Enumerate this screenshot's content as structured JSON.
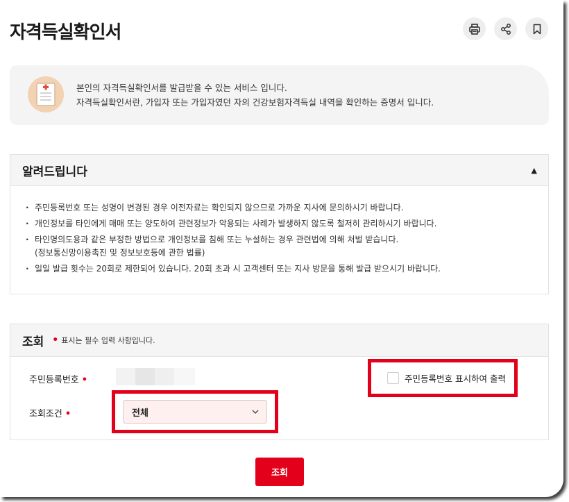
{
  "page": {
    "title": "자격득실확인서"
  },
  "toolbar": {
    "icons": [
      "printer-icon",
      "share-icon",
      "bookmark-icon"
    ]
  },
  "intro": {
    "icon": "medical-document-icon",
    "line1": "본인의 자격득실확인서를 발급받을 수 있는 서비스 입니다.",
    "line2": "자격득실확인서란, 가입자 또는 가입자였던 자의 건강보험자격득실 내역을 확인하는 증명서 입니다."
  },
  "notice": {
    "title": "알려드립니다",
    "toggle_glyph": "▲",
    "items": [
      "주민등록번호 또는 성명이 변경된 경우 이전자료는 확인되지 않으므로 가까운 지사에 문의하시기 바랍니다.",
      "개인정보를 타인에게 매매 또는 양도하여 관련정보가 악용되는 사례가 발생하지 않도록 철저히 관리하시기 바랍니다.",
      "타인명의도용과 같은 부정한 방법으로 개인정보를 침해 또는 누설하는 경우 관련법에 의해 처벌 받습니다.",
      "일일 발급 횟수는 20회로 제한되어 있습니다. 20회 초과 시 고객센터 또는 지사 방문을 통해 발급 받으시기 바랍니다."
    ],
    "item3_sub": "(정보통신망이용촉진 및 정보보호등에 관한 법률)"
  },
  "query": {
    "title": "조회",
    "required_mark": "•",
    "required_note": "표시는 필수 입력 사항입니다.",
    "rrn_label": "주민등록번호",
    "condition_label": "조회조건",
    "checkbox_label": "주민등록번호 표시하여 출력",
    "checkbox_checked": false,
    "condition_value": "전체",
    "submit_label": "조회"
  },
  "colors": {
    "accent": "#e3001b",
    "panel": "#f5f5f5",
    "highlight_border": "#e3001b"
  }
}
